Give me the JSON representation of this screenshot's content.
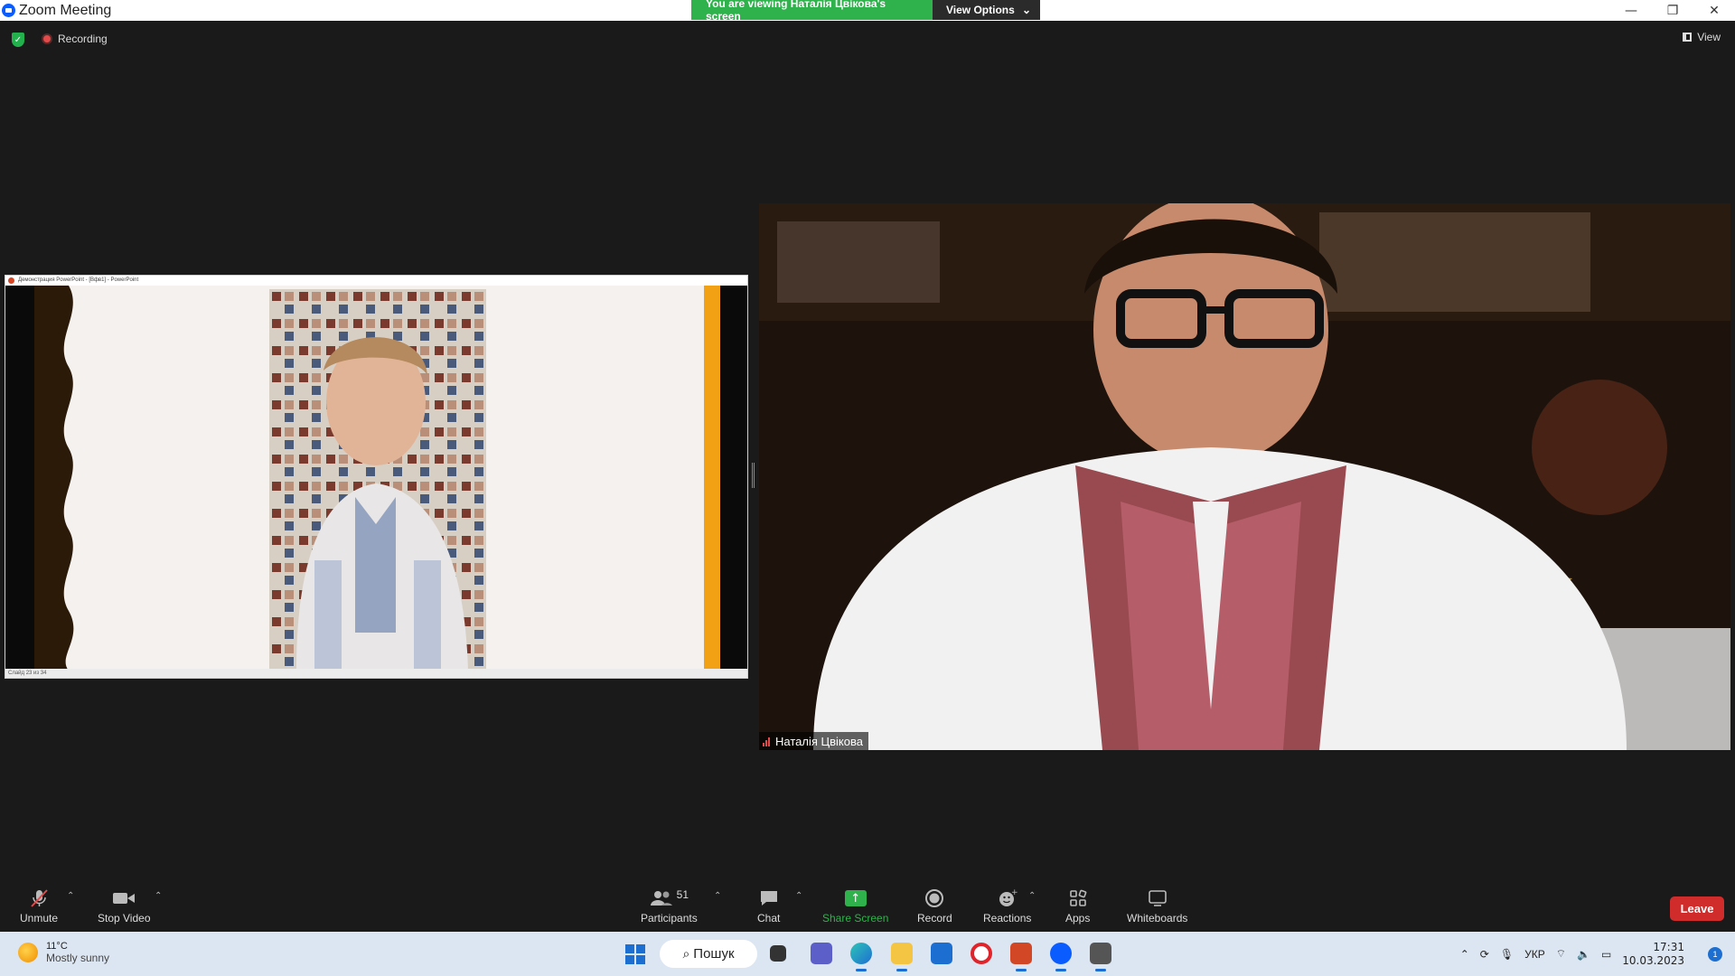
{
  "window": {
    "title": "Zoom Meeting",
    "controls": {
      "minimize": "—",
      "restore": "❐",
      "close": "✕"
    }
  },
  "banner": {
    "message": "You are viewing Наталія Цвікова's screen",
    "options_label": "View Options",
    "options_caret": "⌄"
  },
  "topbar": {
    "security_icon": "shield-icon",
    "recording_label": "Recording",
    "view_label": "View"
  },
  "shared_screen": {
    "window_title": "Демонстрация PowerPoint - [Вфв1] - PowerPoint",
    "status_text": "Слайд 23 из 34"
  },
  "video": {
    "participant_name": "Наталія Цвікова"
  },
  "toolbar": {
    "unmute_label": "Unmute",
    "stop_video_label": "Stop Video",
    "participants_label": "Participants",
    "participants_count": "51",
    "chat_label": "Chat",
    "share_screen_label": "Share Screen",
    "record_label": "Record",
    "reactions_label": "Reactions",
    "apps_label": "Apps",
    "whiteboards_label": "Whiteboards",
    "leave_label": "Leave",
    "caret": "⌃"
  },
  "taskbar": {
    "weather_temp": "11°C",
    "weather_desc": "Mostly sunny",
    "search_label": "Пошук",
    "language": "УКР",
    "time": "17:31",
    "date": "10.03.2023",
    "notification_count": "1"
  },
  "colors": {
    "accent_green": "#2fb24c",
    "leave_red": "#d12c2c",
    "windows_blue": "#1c6fd1"
  }
}
